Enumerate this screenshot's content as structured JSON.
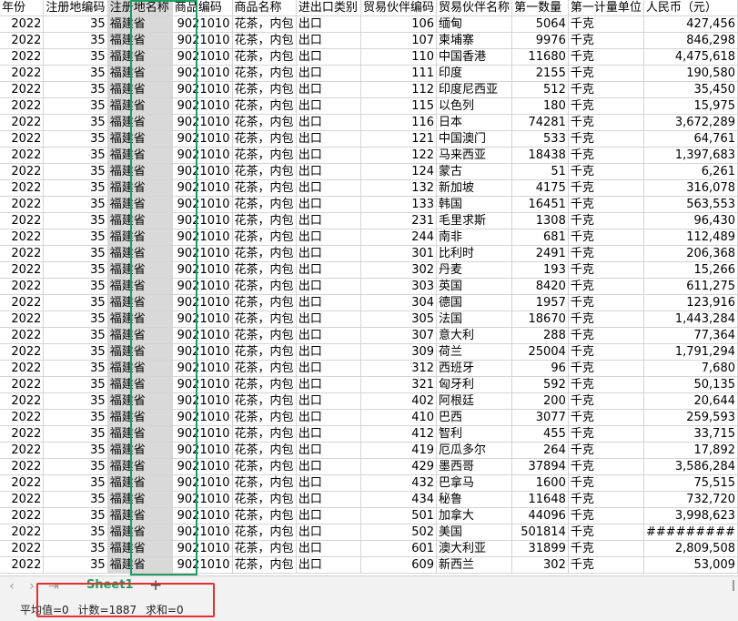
{
  "columns": [
    "年份",
    "注册地编码",
    "注册地名称",
    "商品编码",
    "商品名称",
    "进出口类别",
    "贸易伙伴编码",
    "贸易伙伴名称",
    "第一数量",
    "第一计量单位",
    "人民币（元）"
  ],
  "rows": [
    [
      "2022",
      "35",
      "福建省",
      "9021010",
      "花茶，内包",
      "出口",
      "106",
      "缅甸",
      "5064",
      "千克",
      "427,456"
    ],
    [
      "2022",
      "35",
      "福建省",
      "9021010",
      "花茶，内包",
      "出口",
      "107",
      "柬埔寨",
      "9976",
      "千克",
      "846,298"
    ],
    [
      "2022",
      "35",
      "福建省",
      "9021010",
      "花茶，内包",
      "出口",
      "110",
      "中国香港",
      "11680",
      "千克",
      "4,475,618"
    ],
    [
      "2022",
      "35",
      "福建省",
      "9021010",
      "花茶，内包",
      "出口",
      "111",
      "印度",
      "2155",
      "千克",
      "190,580"
    ],
    [
      "2022",
      "35",
      "福建省",
      "9021010",
      "花茶，内包",
      "出口",
      "112",
      "印度尼西亚",
      "512",
      "千克",
      "35,450"
    ],
    [
      "2022",
      "35",
      "福建省",
      "9021010",
      "花茶，内包",
      "出口",
      "115",
      "以色列",
      "180",
      "千克",
      "15,975"
    ],
    [
      "2022",
      "35",
      "福建省",
      "9021010",
      "花茶，内包",
      "出口",
      "116",
      "日本",
      "74281",
      "千克",
      "3,672,289"
    ],
    [
      "2022",
      "35",
      "福建省",
      "9021010",
      "花茶，内包",
      "出口",
      "121",
      "中国澳门",
      "533",
      "千克",
      "64,761"
    ],
    [
      "2022",
      "35",
      "福建省",
      "9021010",
      "花茶，内包",
      "出口",
      "122",
      "马来西亚",
      "18438",
      "千克",
      "1,397,683"
    ],
    [
      "2022",
      "35",
      "福建省",
      "9021010",
      "花茶，内包",
      "出口",
      "124",
      "蒙古",
      "51",
      "千克",
      "6,261"
    ],
    [
      "2022",
      "35",
      "福建省",
      "9021010",
      "花茶，内包",
      "出口",
      "132",
      "新加坡",
      "4175",
      "千克",
      "316,078"
    ],
    [
      "2022",
      "35",
      "福建省",
      "9021010",
      "花茶，内包",
      "出口",
      "133",
      "韩国",
      "16451",
      "千克",
      "563,553"
    ],
    [
      "2022",
      "35",
      "福建省",
      "9021010",
      "花茶，内包",
      "出口",
      "231",
      "毛里求斯",
      "1308",
      "千克",
      "96,430"
    ],
    [
      "2022",
      "35",
      "福建省",
      "9021010",
      "花茶，内包",
      "出口",
      "244",
      "南非",
      "681",
      "千克",
      "112,489"
    ],
    [
      "2022",
      "35",
      "福建省",
      "9021010",
      "花茶，内包",
      "出口",
      "301",
      "比利时",
      "2491",
      "千克",
      "206,368"
    ],
    [
      "2022",
      "35",
      "福建省",
      "9021010",
      "花茶，内包",
      "出口",
      "302",
      "丹麦",
      "193",
      "千克",
      "15,266"
    ],
    [
      "2022",
      "35",
      "福建省",
      "9021010",
      "花茶，内包",
      "出口",
      "303",
      "英国",
      "8420",
      "千克",
      "611,275"
    ],
    [
      "2022",
      "35",
      "福建省",
      "9021010",
      "花茶，内包",
      "出口",
      "304",
      "德国",
      "1957",
      "千克",
      "123,916"
    ],
    [
      "2022",
      "35",
      "福建省",
      "9021010",
      "花茶，内包",
      "出口",
      "305",
      "法国",
      "18670",
      "千克",
      "1,443,284"
    ],
    [
      "2022",
      "35",
      "福建省",
      "9021010",
      "花茶，内包",
      "出口",
      "307",
      "意大利",
      "288",
      "千克",
      "77,364"
    ],
    [
      "2022",
      "35",
      "福建省",
      "9021010",
      "花茶，内包",
      "出口",
      "309",
      "荷兰",
      "25004",
      "千克",
      "1,791,294"
    ],
    [
      "2022",
      "35",
      "福建省",
      "9021010",
      "花茶，内包",
      "出口",
      "312",
      "西班牙",
      "96",
      "千克",
      "7,680"
    ],
    [
      "2022",
      "35",
      "福建省",
      "9021010",
      "花茶，内包",
      "出口",
      "321",
      "匈牙利",
      "592",
      "千克",
      "50,135"
    ],
    [
      "2022",
      "35",
      "福建省",
      "9021010",
      "花茶，内包",
      "出口",
      "402",
      "阿根廷",
      "200",
      "千克",
      "20,644"
    ],
    [
      "2022",
      "35",
      "福建省",
      "9021010",
      "花茶，内包",
      "出口",
      "410",
      "巴西",
      "3077",
      "千克",
      "259,593"
    ],
    [
      "2022",
      "35",
      "福建省",
      "9021010",
      "花茶，内包",
      "出口",
      "412",
      "智利",
      "455",
      "千克",
      "33,715"
    ],
    [
      "2022",
      "35",
      "福建省",
      "9021010",
      "花茶，内包",
      "出口",
      "419",
      "厄瓜多尔",
      "264",
      "千克",
      "17,892"
    ],
    [
      "2022",
      "35",
      "福建省",
      "9021010",
      "花茶，内包",
      "出口",
      "429",
      "墨西哥",
      "37894",
      "千克",
      "3,586,284"
    ],
    [
      "2022",
      "35",
      "福建省",
      "9021010",
      "花茶，内包",
      "出口",
      "432",
      "巴拿马",
      "1600",
      "千克",
      "75,515"
    ],
    [
      "2022",
      "35",
      "福建省",
      "9021010",
      "花茶，内包",
      "出口",
      "434",
      "秘鲁",
      "11648",
      "千克",
      "732,720"
    ],
    [
      "2022",
      "35",
      "福建省",
      "9021010",
      "花茶，内包",
      "出口",
      "501",
      "加拿大",
      "44096",
      "千克",
      "3,998,623"
    ],
    [
      "2022",
      "35",
      "福建省",
      "9021010",
      "花茶，内包",
      "出口",
      "502",
      "美国",
      "501814",
      "千克",
      "#########"
    ],
    [
      "2022",
      "35",
      "福建省",
      "9021010",
      "花茶，内包",
      "出口",
      "601",
      "澳大利亚",
      "31899",
      "千克",
      "2,809,508"
    ],
    [
      "2022",
      "35",
      "福建省",
      "9021010",
      "花茶，内包",
      "出口",
      "609",
      "新西兰",
      "302",
      "千克",
      "53,009"
    ]
  ],
  "sheet_tab": "Sheet1",
  "add_sheet": "+",
  "status": {
    "avg": "平均值=0",
    "count": "计数=1887",
    "sum": "求和=0"
  },
  "colors": {
    "selection": "#1f9d63",
    "highlight": "#e52e2e"
  }
}
